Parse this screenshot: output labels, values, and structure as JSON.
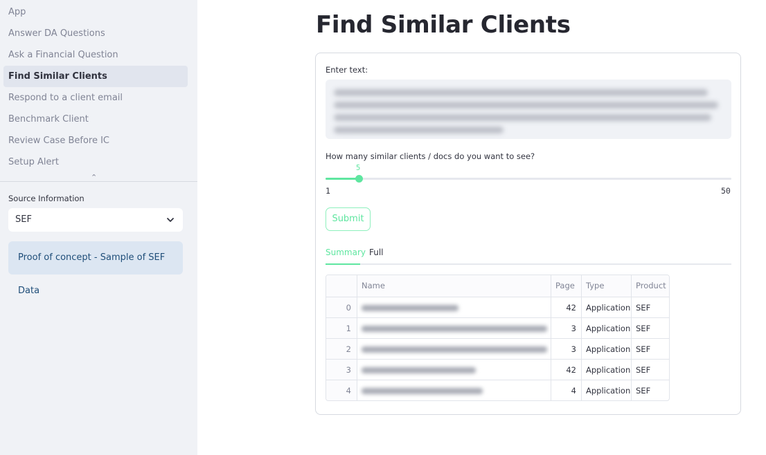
{
  "sidebar": {
    "nav_items": [
      {
        "label": "App",
        "active": false
      },
      {
        "label": "Answer DA Questions",
        "active": false
      },
      {
        "label": "Ask a Financial Question",
        "active": false
      },
      {
        "label": "Find Similar Clients",
        "active": true
      },
      {
        "label": "Respond to a client email",
        "active": false
      },
      {
        "label": "Benchmark Client",
        "active": false
      },
      {
        "label": "Review Case Before IC",
        "active": false
      },
      {
        "label": "Setup Alert",
        "active": false
      }
    ],
    "source_label": "Source Information",
    "source_value": "SEF",
    "info_text": "Proof of concept - Sample of SEF Data"
  },
  "main": {
    "title": "Find Similar Clients",
    "enter_text_label": "Enter text:",
    "slider_label": "How many similar clients / docs do you want to see?",
    "slider": {
      "value": "5",
      "min": "1",
      "max": "50"
    },
    "submit_label": "Submit",
    "tabs": [
      {
        "label": "Summary",
        "active": true
      },
      {
        "label": "Full",
        "active": false
      }
    ],
    "table": {
      "columns": [
        "",
        "Name",
        "Page",
        "Type",
        "Product"
      ],
      "rows": [
        {
          "idx": "0",
          "page": "42",
          "type": "Application",
          "product": "SEF"
        },
        {
          "idx": "1",
          "page": "3",
          "type": "Application",
          "product": "SEF"
        },
        {
          "idx": "2",
          "page": "3",
          "type": "Application",
          "product": "SEF"
        },
        {
          "idx": "3",
          "page": "42",
          "type": "Application",
          "product": "SEF"
        },
        {
          "idx": "4",
          "page": "4",
          "type": "Application",
          "product": "SEF"
        }
      ]
    }
  },
  "colors": {
    "accent": "#5fe6a0",
    "sidebar_bg": "#f0f2f6",
    "info_bg": "#dce6f2"
  }
}
